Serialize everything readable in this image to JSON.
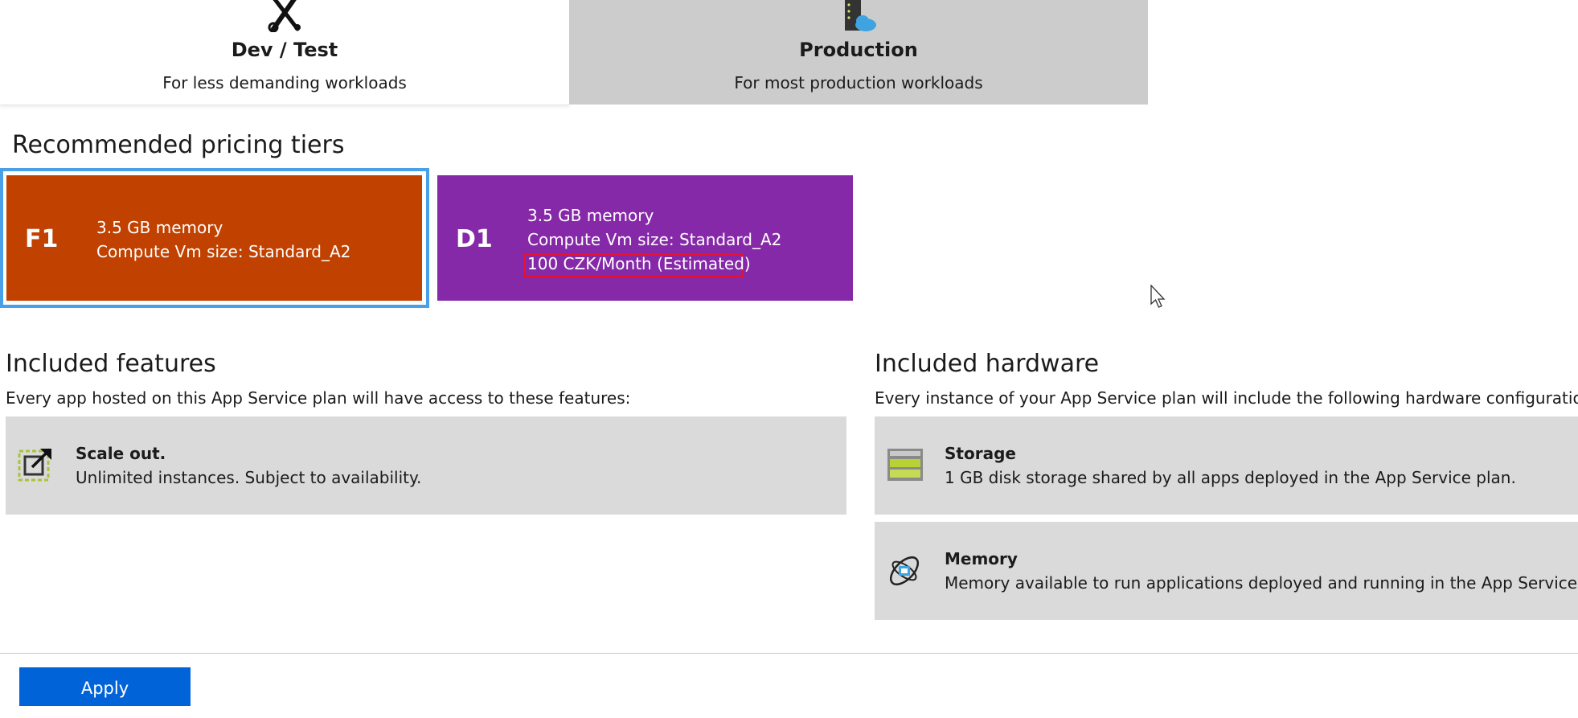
{
  "workload_tabs": [
    {
      "title": "Dev / Test",
      "subtitle": "For less demanding workloads",
      "icon": "tools-icon"
    },
    {
      "title": "Production",
      "subtitle": "For most production workloads",
      "icon": "server-cloud-icon"
    }
  ],
  "recommended": {
    "title": "Recommended pricing tiers",
    "tiers": [
      {
        "code": "F1",
        "memory": "3.5 GB memory",
        "vm_size": "Compute Vm size: Standard_A2",
        "color": "#c14100"
      },
      {
        "code": "D1",
        "memory": "3.5 GB memory",
        "vm_size": "Compute Vm size: Standard_A2",
        "price": "100 CZK/Month (Estimated)",
        "color": "#8629a8"
      }
    ]
  },
  "features": {
    "title": "Included features",
    "description": "Every app hosted on this App Service plan will have access to these features:",
    "items": [
      {
        "title": "Scale out.",
        "description": "Unlimited instances. Subject to availability.",
        "icon": "scale-out-icon"
      }
    ]
  },
  "hardware": {
    "title": "Included hardware",
    "description": "Every instance of your App Service plan will include the following hardware configuration:",
    "items": [
      {
        "title": "Storage",
        "description": "1 GB disk storage shared by all apps deployed in the App Service plan.",
        "icon": "storage-icon"
      },
      {
        "title": "Memory",
        "description": "Memory available to run applications deployed and running in the App Service plan.",
        "icon": "memory-icon"
      }
    ]
  },
  "actions": {
    "apply_label": "Apply"
  },
  "colors": {
    "accent": "#0063d8",
    "selection": "#4aa0e6",
    "highlight": "#e8112d"
  }
}
